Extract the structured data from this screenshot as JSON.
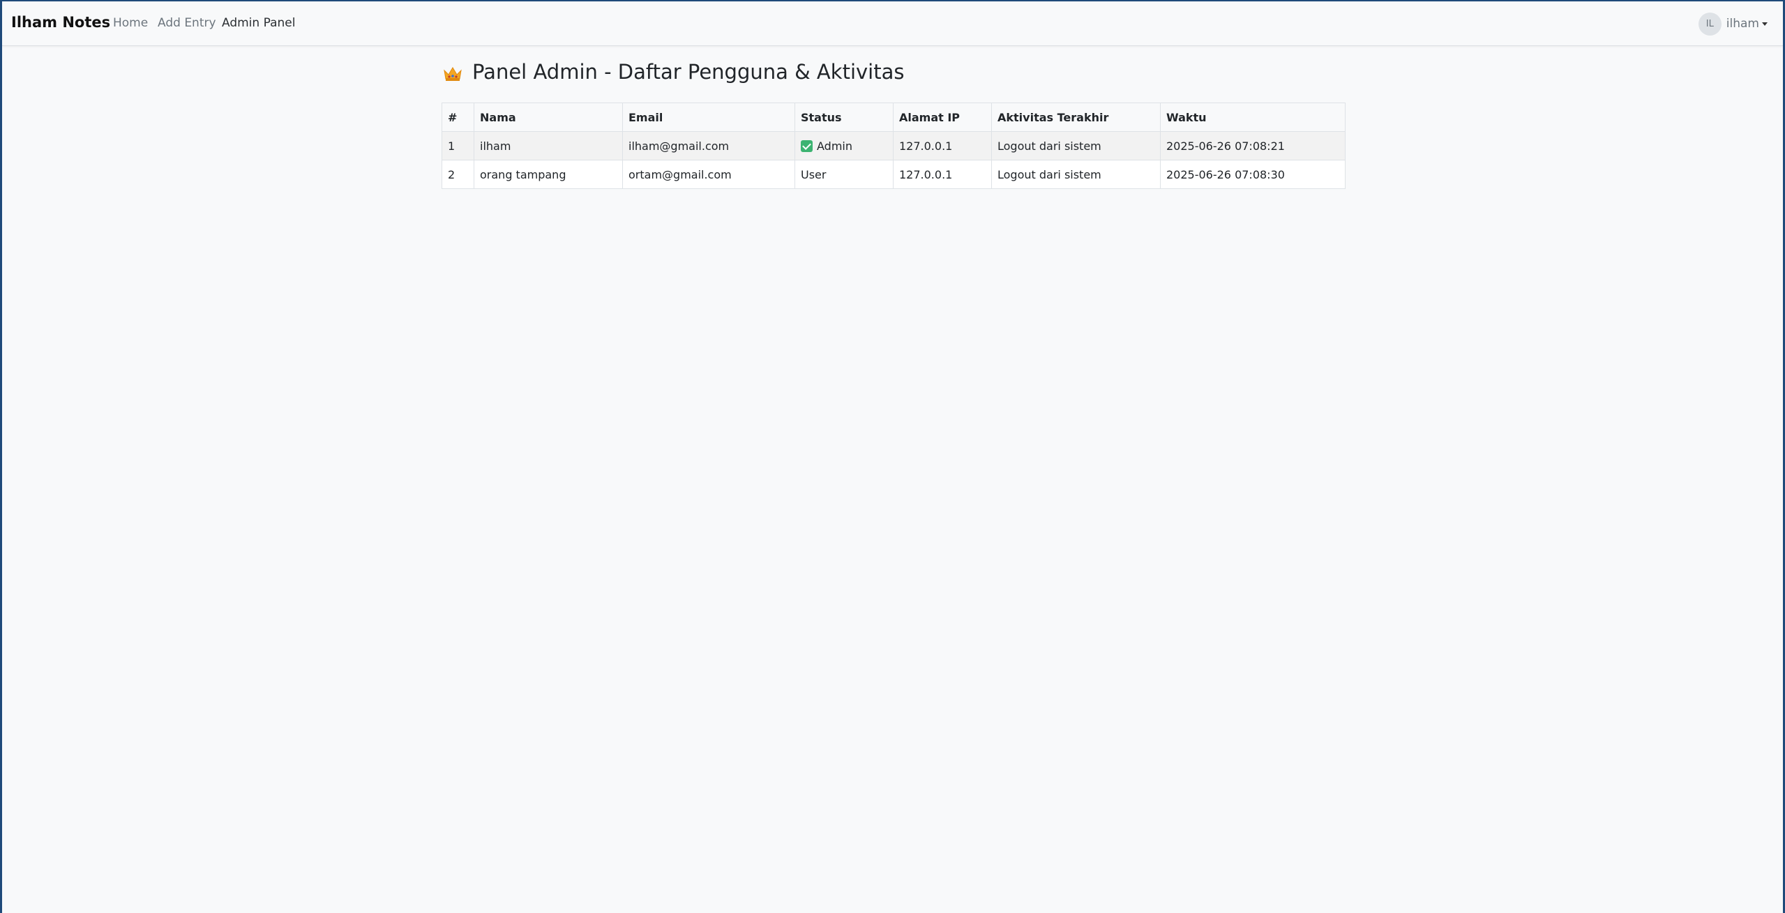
{
  "navbar": {
    "brand": "Ilham Notes",
    "links": [
      "Home",
      "Add Entry",
      "Admin Panel"
    ],
    "active_link": "Admin Panel",
    "user": {
      "initials": "IL",
      "name": "ilham"
    }
  },
  "page": {
    "title": "Panel Admin - Daftar Pengguna & Aktivitas",
    "title_icon": "crown-icon"
  },
  "table": {
    "headers": [
      "#",
      "Nama",
      "Email",
      "Status",
      "Alamat IP",
      "Aktivitas Terakhir",
      "Waktu"
    ],
    "rows": [
      {
        "no": "1",
        "nama": "ilham",
        "email": "ilham@gmail.com",
        "status": "Admin",
        "status_icon": "check-icon",
        "ip": "127.0.0.1",
        "aktivitas": "Logout dari sistem",
        "waktu": "2025-06-26 07:08:21"
      },
      {
        "no": "2",
        "nama": "orang tampang",
        "email": "ortam@gmail.com",
        "status": "User",
        "ip": "127.0.0.1",
        "aktivitas": "Logout dari sistem",
        "waktu": "2025-06-26 07:08:30"
      }
    ]
  },
  "colors": {
    "page_background": "#f8f9fa",
    "check_green": "#3cb371",
    "crown_gold": "#f4a623"
  }
}
